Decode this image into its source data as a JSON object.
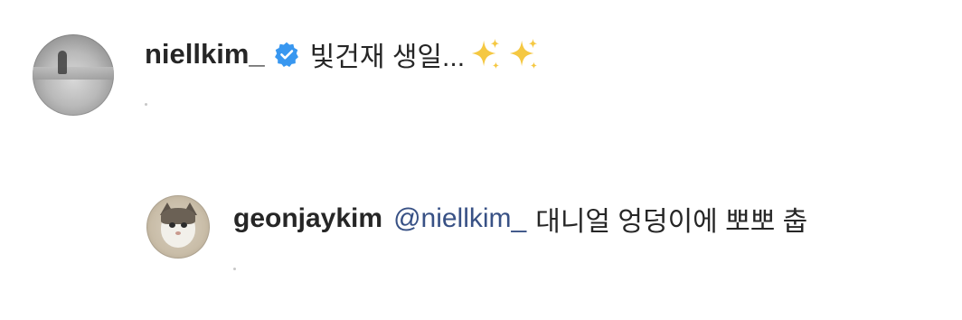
{
  "comments": [
    {
      "username": "niellkim_",
      "verified": true,
      "text": "빛건재 생일...",
      "emoji": "sparkles"
    }
  ],
  "reply": {
    "username": "geonjaykim",
    "mention": "@niellkim_",
    "text": "대니얼 엉덩이에 뽀뽀 춥"
  },
  "colors": {
    "username": "#262626",
    "mention": "#385185",
    "verified_badge": "#3897f0",
    "sparkle": "#f5c842"
  },
  "icons": {
    "verified": "verified-badge-icon",
    "sparkles": "sparkles-icon"
  }
}
